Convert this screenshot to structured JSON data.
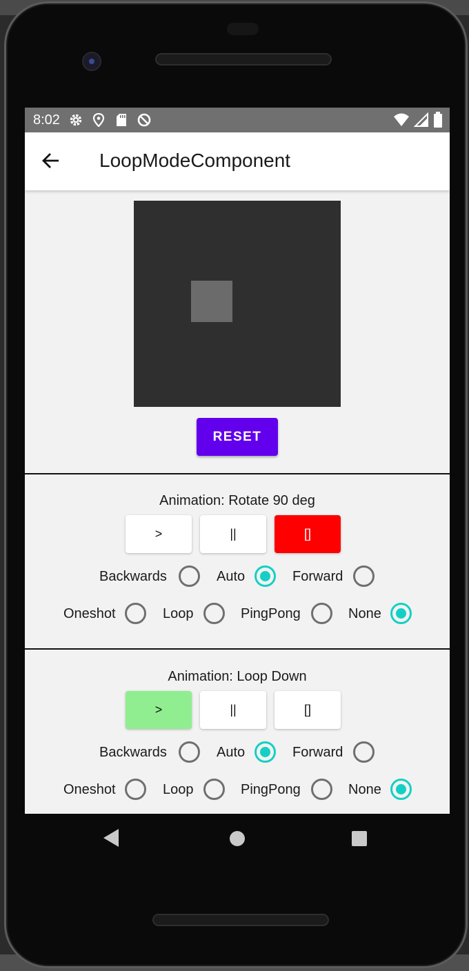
{
  "statusbar": {
    "time": "8:02",
    "icons": [
      "gear-icon",
      "location-icon",
      "sd-card-icon",
      "data-saver-icon",
      "wifi-icon",
      "signal-icon",
      "battery-icon"
    ]
  },
  "appbar": {
    "title": "LoopModeComponent",
    "back_icon": "arrow-back-icon"
  },
  "preview": {
    "reset_label": "RESET",
    "reset_color": "#6200ee"
  },
  "sections": [
    {
      "title": "Animation: Rotate 90 deg",
      "buttons": {
        "play": ">",
        "pause": "||",
        "stop": "[]"
      },
      "button_colors": {
        "play": "#ffffff",
        "pause": "#ffffff",
        "stop": "#ff0000"
      },
      "direction": {
        "options": [
          "Backwards",
          "Auto",
          "Forward"
        ],
        "selected": "Auto"
      },
      "loop_mode": {
        "options": [
          "Oneshot",
          "Loop",
          "PingPong",
          "None"
        ],
        "selected": "None"
      }
    },
    {
      "title": "Animation: Loop Down",
      "buttons": {
        "play": ">",
        "pause": "||",
        "stop": "[]"
      },
      "button_colors": {
        "play": "#90ee90",
        "pause": "#ffffff",
        "stop": "#ffffff"
      },
      "direction": {
        "options": [
          "Backwards",
          "Auto",
          "Forward"
        ],
        "selected": "Auto"
      },
      "loop_mode": {
        "options": [
          "Oneshot",
          "Loop",
          "PingPong",
          "None"
        ],
        "selected": "None"
      }
    }
  ],
  "navbar": {
    "icons": [
      "nav-back-icon",
      "nav-home-icon",
      "nav-recent-icon"
    ]
  },
  "colors": {
    "accent_radio": "#14d0c4",
    "screen_bg": "#f2f2f2"
  }
}
